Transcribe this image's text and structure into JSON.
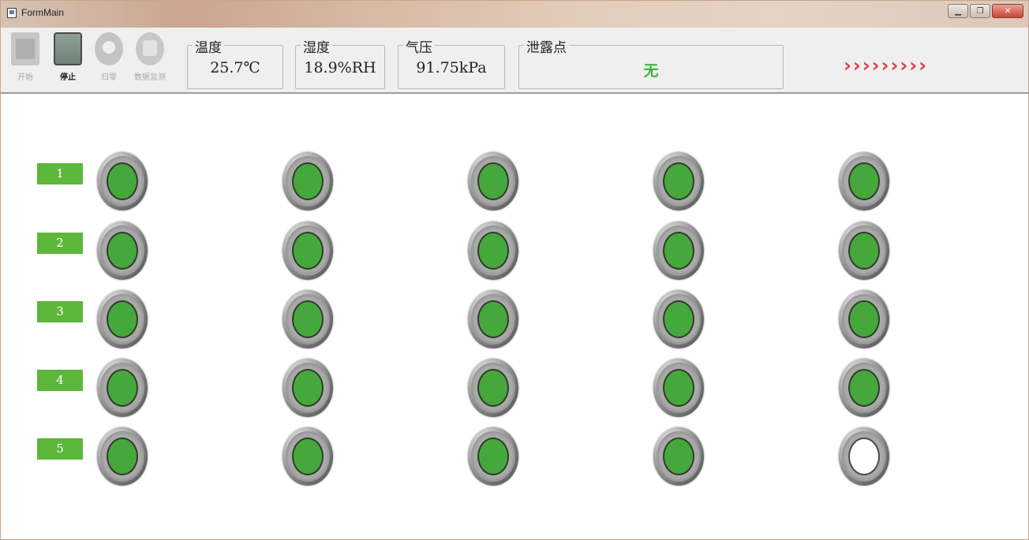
{
  "window": {
    "title": "FormMain",
    "controls": [
      "minimize",
      "restore",
      "close"
    ]
  },
  "toolbar": {
    "buttons": [
      {
        "id": "start",
        "label": "开始",
        "icon": "play-icon",
        "enabled": false
      },
      {
        "id": "stop",
        "label": "停止",
        "icon": "stop-icon",
        "enabled": true
      },
      {
        "id": "reset",
        "label": "归零",
        "icon": "reset-icon",
        "enabled": false
      },
      {
        "id": "monitor",
        "label": "数据监测",
        "icon": "monitor-icon",
        "enabled": false
      }
    ],
    "readings": [
      {
        "id": "temperature",
        "label": "温度",
        "value": "25.7℃"
      },
      {
        "id": "humidity",
        "label": "湿度",
        "value": "18.9%RH"
      },
      {
        "id": "pressure",
        "label": "气压",
        "value": "91.75kPa"
      },
      {
        "id": "dewpoint",
        "label": "泄露点",
        "value": "无"
      }
    ],
    "arrows": "›››››››››",
    "arrow_color": "#e23b3b"
  },
  "grid": {
    "rows": [
      {
        "label": "1",
        "lamps": [
          "on",
          "on",
          "on",
          "on",
          "on"
        ]
      },
      {
        "label": "2",
        "lamps": [
          "on",
          "on",
          "on",
          "on",
          "on"
        ]
      },
      {
        "label": "3",
        "lamps": [
          "on",
          "on",
          "on",
          "on",
          "on"
        ]
      },
      {
        "label": "4",
        "lamps": [
          "on",
          "on",
          "on",
          "on",
          "on"
        ]
      },
      {
        "label": "5",
        "lamps": [
          "on",
          "on",
          "on",
          "on",
          "off"
        ]
      }
    ],
    "on_color": "#46a83c",
    "off_color": "#ffffff",
    "label_color": "#5cb73a"
  }
}
